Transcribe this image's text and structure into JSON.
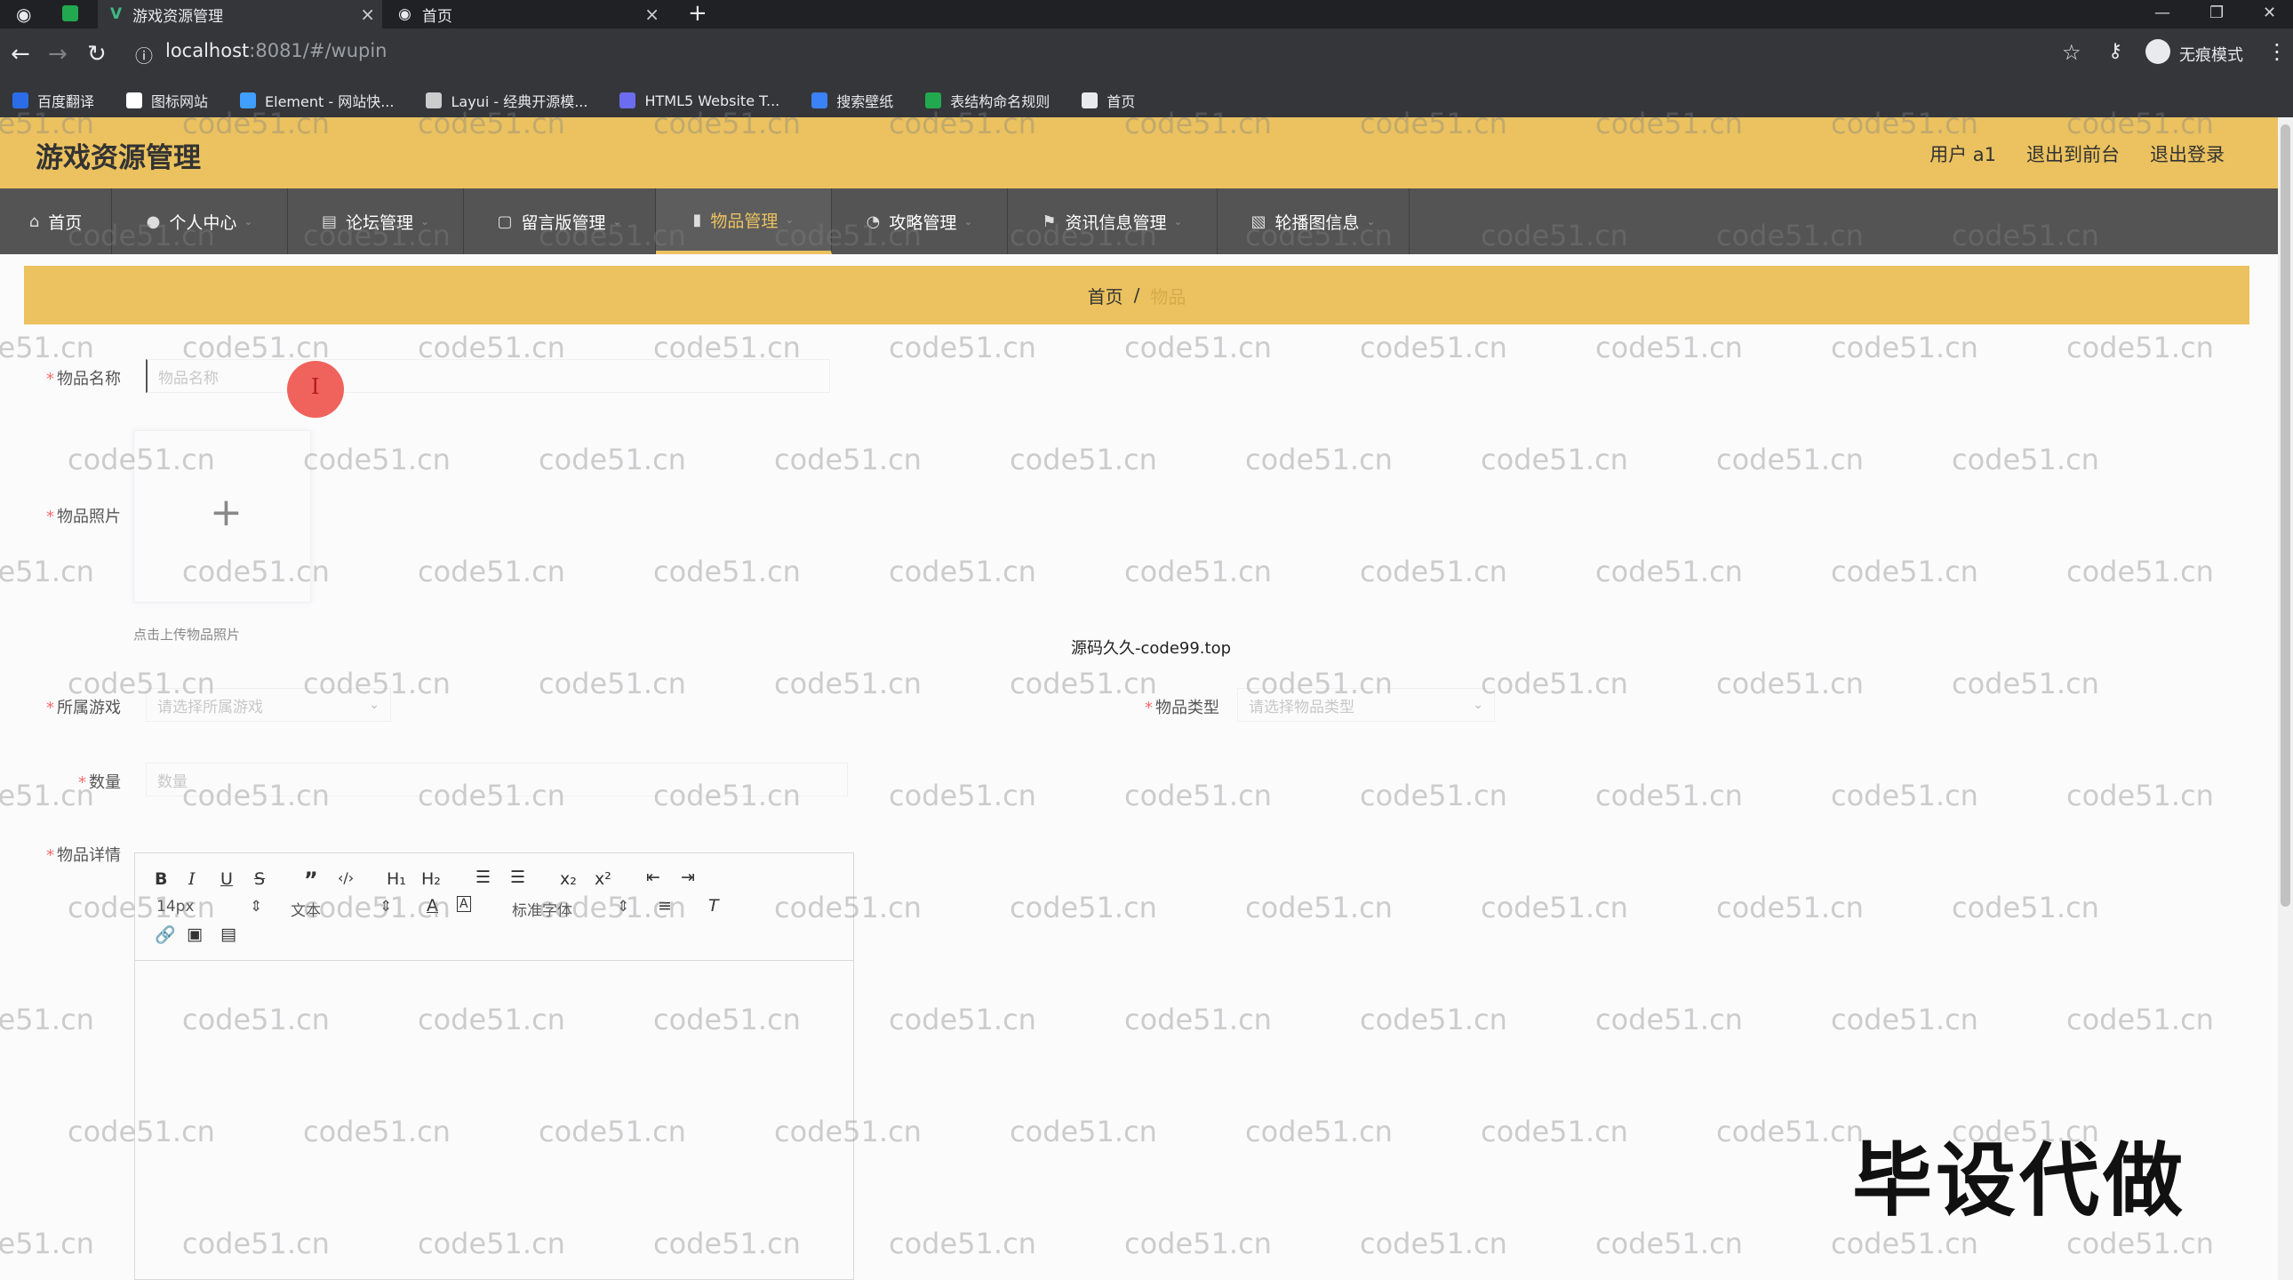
{
  "browser": {
    "tabs": [
      {
        "title": "游戏资源管理",
        "active": true
      },
      {
        "title": "首页",
        "active": false
      }
    ],
    "new_tab": "+",
    "url_host": "localhost",
    "url_rest": ":8081/#/wupin",
    "incognito_label": "无痕模式",
    "bookmarks": [
      {
        "label": "百度翻译",
        "color": "#2b6de8"
      },
      {
        "label": "图标网站",
        "color": "#ffffff"
      },
      {
        "label": "Element - 网站快...",
        "color": "#409eff"
      },
      {
        "label": "Layui - 经典开源模...",
        "color": "#cccccc"
      },
      {
        "label": "HTML5 Website T...",
        "color": "#6c6cf0"
      },
      {
        "label": "搜索壁纸",
        "color": "#3b82f6"
      },
      {
        "label": "表结构命名规则",
        "color": "#22a94f"
      },
      {
        "label": "首页",
        "color": "#e8eaed"
      }
    ]
  },
  "app": {
    "title": "游戏资源管理",
    "user": "用户 a1",
    "back_to_front": "退出到前台",
    "logout": "退出登录",
    "accent_color": "#ebc25f",
    "nav": [
      {
        "label": "首页",
        "icon": "home-icon",
        "glyph": "⌂"
      },
      {
        "label": "个人中心",
        "icon": "user-icon",
        "glyph": "●"
      },
      {
        "label": "论坛管理",
        "icon": "forum-icon",
        "glyph": "▤"
      },
      {
        "label": "留言版管理",
        "icon": "message-icon",
        "glyph": "▢"
      },
      {
        "label": "物品管理",
        "icon": "bar-chart-icon",
        "glyph": "▮",
        "active": true
      },
      {
        "label": "攻略管理",
        "icon": "guide-icon",
        "glyph": "◔"
      },
      {
        "label": "资讯信息管理",
        "icon": "flag-icon",
        "glyph": "⚑"
      },
      {
        "label": "轮播图信息",
        "icon": "carousel-icon",
        "glyph": "▧"
      }
    ],
    "breadcrumb": {
      "home": "首页",
      "sep": "/",
      "current": "物品"
    }
  },
  "form": {
    "name_label": "物品名称",
    "name_placeholder": "物品名称",
    "photo_label": "物品照片",
    "upload_plus": "+",
    "upload_tip": "点击上传物品照片",
    "game_label": "所属游戏",
    "game_placeholder": "请选择所属游戏",
    "type_label": "物品类型",
    "type_placeholder": "请选择物品类型",
    "qty_label": "数量",
    "qty_placeholder": "数量",
    "detail_label": "物品详情",
    "required_mark": "*"
  },
  "editor": {
    "font_size": "14px",
    "heading": "文本",
    "font_family": "标准字体"
  },
  "center_note": "源码久久-code99.top",
  "promo_text": "毕设代做",
  "watermark": "code51.cn"
}
